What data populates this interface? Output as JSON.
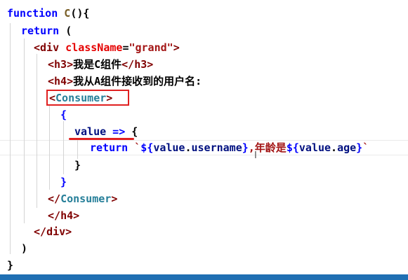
{
  "code": {
    "l1": {
      "kw": "function",
      "name": " C",
      "rest": "(){"
    },
    "l2": {
      "kw": "return",
      "rest": " ("
    },
    "l3": {
      "open": "<",
      "tag": "div",
      "attr": "className",
      "eq": "=",
      "val": "\"grand\"",
      "close": ">"
    },
    "l4": {
      "open": "<",
      "tag": "h3",
      "close": ">",
      "text": "我是C组件",
      "end_open": "</",
      "end_tag": "h3",
      "end_close": ">"
    },
    "l5": {
      "open": "<",
      "tag": "h4",
      "close": ">",
      "text": "我从A组件接收到的用户名:"
    },
    "l6": {
      "open": "<",
      "tag": "Consumer",
      "close": ">"
    },
    "l7": {
      "brace": "{"
    },
    "l8": {
      "param": "value",
      "arrow": " =>",
      "brace": " {"
    },
    "l9": {
      "kw": "return",
      "sp": " ",
      "bt1": "`",
      "tpl1_open": "${",
      "tpl1_obj": "value",
      "tpl1_dot": ".",
      "tpl1_prop": "username",
      "tpl1_close": "}",
      "mid": ",年龄是",
      "tpl2_open": "${",
      "tpl2_obj": "value",
      "tpl2_dot": ".",
      "tpl2_prop": "age",
      "tpl2_close": "}",
      "bt2": "`"
    },
    "l10": {
      "brace": "}"
    },
    "l11": {
      "brace": "}"
    },
    "l12": {
      "open": "</",
      "tag": "Consumer",
      "close": ">"
    },
    "l13": {
      "open": "</",
      "tag": "h4",
      "close": ">"
    },
    "l14": {
      "open": "</",
      "tag": "div",
      "close": ">"
    },
    "l15": {
      "paren": ")"
    },
    "l16": {
      "brace": "}"
    }
  },
  "cursor": {
    "glyph": "I"
  },
  "colors": {
    "highlight_box": "#e02020",
    "statusbar": "#1f6fb3"
  }
}
